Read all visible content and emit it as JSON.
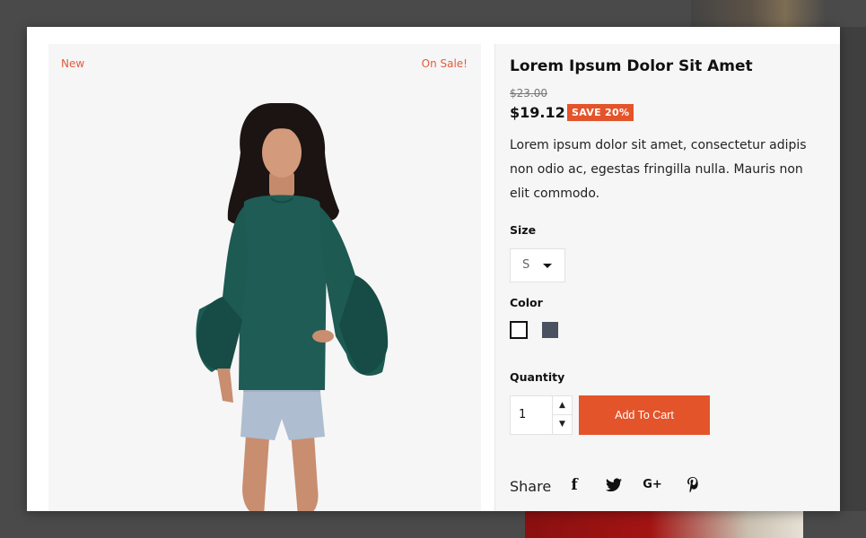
{
  "product": {
    "title": "Lorem Ipsum Dolor Sit Amet",
    "old_price": "$23.00",
    "new_price": "$19.12",
    "save_label": "SAVE 20%",
    "description_lines": [
      "Lorem ipsum dolor sit amet, consectetur adipis",
      "non odio ac, egestas fringilla nulla. Mauris non",
      "elit commodo."
    ]
  },
  "badges": {
    "new": "New",
    "sale": "On Sale!"
  },
  "options": {
    "size_label": "Size",
    "size_value": "S",
    "color_label": "Color",
    "colors": [
      "#ffffff",
      "#4a5261"
    ],
    "quantity_label": "Quantity",
    "quantity_value": "1"
  },
  "actions": {
    "add_to_cart": "Add To Cart"
  },
  "share": {
    "label": "Share",
    "icons": [
      "facebook-icon",
      "twitter-icon",
      "google-plus-icon",
      "pinterest-icon"
    ]
  },
  "theme": {
    "accent": "#e4542a",
    "panel_bg": "#f6f6f6",
    "overlay": "#4a4a4a"
  }
}
